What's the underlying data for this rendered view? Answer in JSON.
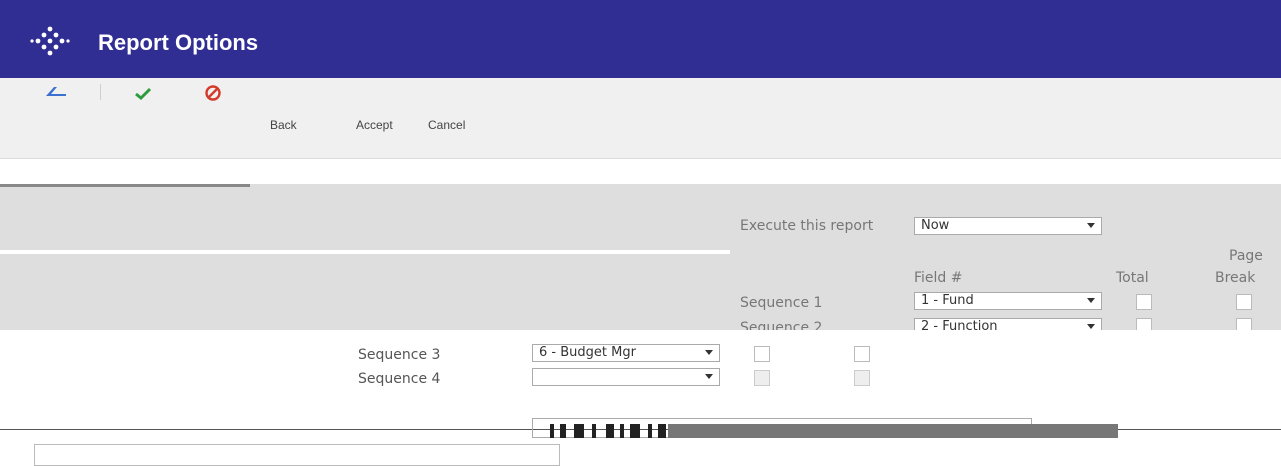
{
  "window": {
    "title": "Report Options"
  },
  "toolbar": {
    "back_label": "Back",
    "accept_label": "Accept",
    "cancel_label": "Cancel"
  },
  "form": {
    "execute_label": "Execute this report",
    "execute_value": "Now",
    "field_header": "Field #",
    "total_header": "Total",
    "page_header": "Page",
    "break_header": "Break",
    "sequences": [
      {
        "label": "Sequence 1",
        "value": "1 - Fund"
      },
      {
        "label": "Sequence 2",
        "value": "2 - Function"
      },
      {
        "label": "Sequence 3",
        "value": "6 - Budget Mgr"
      },
      {
        "label": "Sequence 4",
        "value": ""
      }
    ]
  },
  "colors": {
    "titlebar": "#312e93",
    "accept": "#2e9b3c",
    "cancel": "#d43a2a",
    "back": "#3b6fd0"
  },
  "icons": [
    "logo-icon",
    "back-icon",
    "accept-icon",
    "cancel-icon",
    "dropdown-arrow-icon"
  ]
}
